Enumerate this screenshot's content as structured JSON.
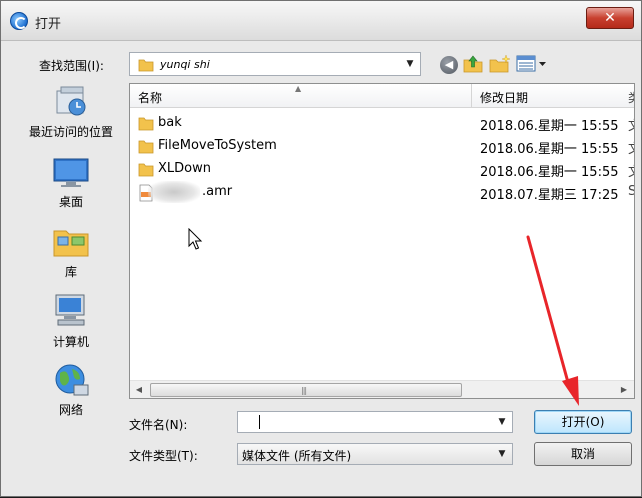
{
  "window": {
    "title": "打开",
    "close_symbol": "✕"
  },
  "toolbar": {
    "look_in_label": "查找范围(I):",
    "look_in_value": "yunqi shi",
    "back_symbol": "◀"
  },
  "places": [
    {
      "label": "最近访问的位置",
      "icon": "recent-places-icon"
    },
    {
      "label": "桌面",
      "icon": "desktop-icon"
    },
    {
      "label": "库",
      "icon": "libraries-icon"
    },
    {
      "label": "计算机",
      "icon": "computer-icon"
    },
    {
      "label": "网络",
      "icon": "network-icon"
    }
  ],
  "file_list": {
    "columns": {
      "name": "名称",
      "date_modified": "修改日期",
      "next_column_cut": "类"
    },
    "rows": [
      {
        "name": "bak",
        "date": "2018.06.星期一 15:55",
        "cut": "文",
        "type": "folder"
      },
      {
        "name": "FileMoveToSystem",
        "date": "2018.06.星期一 15:55",
        "cut": "文",
        "type": "folder"
      },
      {
        "name": "XLDown",
        "date": "2018.06.星期一 15:55",
        "cut": "文",
        "type": "folder"
      },
      {
        "name": ".amr",
        "date": "2018.07.星期三 17:25",
        "cut": "S",
        "type": "amr-file"
      }
    ],
    "scroll_grip": "|||"
  },
  "form": {
    "filename_label": "文件名(N):",
    "filename_value": "",
    "filetype_label": "文件类型(T):",
    "filetype_value": "媒体文件 (所有文件)",
    "open_button": "打开(O)",
    "cancel_button": "取消"
  },
  "colors": {
    "annotation_arrow": "#e8252a",
    "folder": "#f2c24c",
    "open_button_border": "#3c7fb1"
  }
}
